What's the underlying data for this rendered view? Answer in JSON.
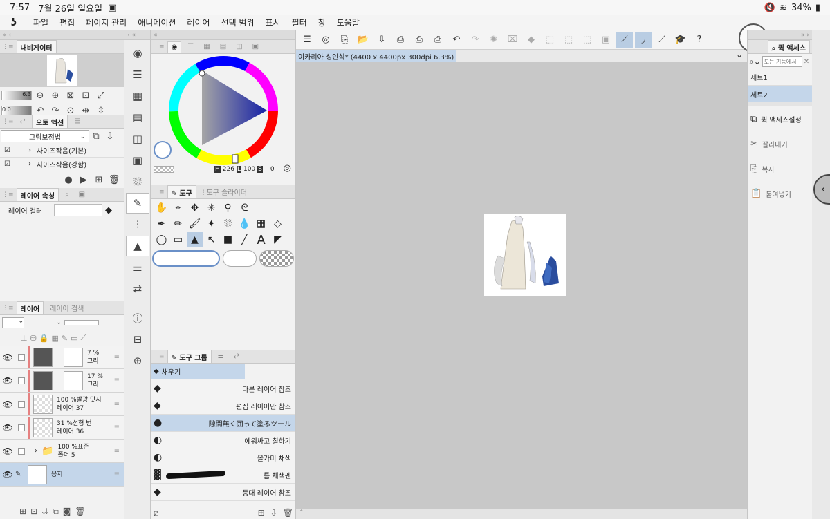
{
  "status": {
    "time": "7:57",
    "date": "7월 26일 일요일",
    "battery": "34%"
  },
  "menu": {
    "logo": "ʖ",
    "items": [
      "파일",
      "편집",
      "페이지 관리",
      "애니메이션",
      "레이어",
      "선택 범위",
      "표시",
      "필터",
      "창",
      "도움말"
    ]
  },
  "navigator": {
    "tab": "내비게이터",
    "zoom": "6.3",
    "angle": "0.0"
  },
  "autoaction": {
    "tab": "오토 액션",
    "set": "그림보정법",
    "items": [
      "사이즈작음(기본)",
      "사이즈작음(강함)"
    ]
  },
  "layerprop": {
    "tab": "레이어 속성",
    "color_label": "레이어 컬러"
  },
  "layers": {
    "tab": "레이어",
    "search_tab": "레이어 검색",
    "items": [
      {
        "line1": "7 %",
        "line2": "그리",
        "thumb": "dark",
        "mask": true,
        "sel": false
      },
      {
        "line1": "17 %",
        "line2": "그리",
        "thumb": "dark",
        "mask": true,
        "sel": false
      },
      {
        "line1": "100 %발광 닷지",
        "line2": "레이어 37",
        "thumb": "checker",
        "mask": false,
        "sel": false
      },
      {
        "line1": "31 %선형 번",
        "line2": "레이어 36",
        "thumb": "checker",
        "mask": false,
        "sel": false
      },
      {
        "line1": "100 %표준",
        "line2": "폴더 5",
        "thumb": "folder",
        "mask": false,
        "sel": false
      },
      {
        "line1": "",
        "line2": "용지",
        "thumb": "white",
        "mask": false,
        "sel": true
      }
    ]
  },
  "color": {
    "h": "H",
    "h_val": "226",
    "l": "L",
    "l_val": "100",
    "s": "S",
    "s_val": "0"
  },
  "tool": {
    "tab": "도구",
    "slider_tab": "도구 슬라이더"
  },
  "subtool": {
    "tab": "도구 그룹",
    "current": "채우기",
    "items": [
      "다른 레이어 참조",
      "편집 레이어만 참조",
      "隙間無く囲って塗るツール",
      "에워싸고 칠하기",
      "올가미 채색",
      "틈 채색펜",
      "등대 레이어 참조"
    ],
    "selected_index": 2
  },
  "canvas": {
    "title": "이카리아 성인식* (4400 x 4400px 300dpi 6.3%)"
  },
  "quickaccess": {
    "tab": "퀵 액세스",
    "search_placeholder": "모든 기능에서",
    "sets": [
      "세트1",
      "세트2"
    ],
    "items": [
      {
        "icon": "settings-icon",
        "label": "퀵 액세스설정"
      },
      {
        "icon": "scissors-icon",
        "label": "잘라내기"
      },
      {
        "icon": "copy-icon",
        "label": "복사"
      },
      {
        "icon": "paste-icon",
        "label": "붙여넣기"
      }
    ]
  },
  "colors": {
    "accent": "#b9cde3",
    "canvas_bg": "#c8c8c8",
    "layer_red": "#e58080"
  }
}
